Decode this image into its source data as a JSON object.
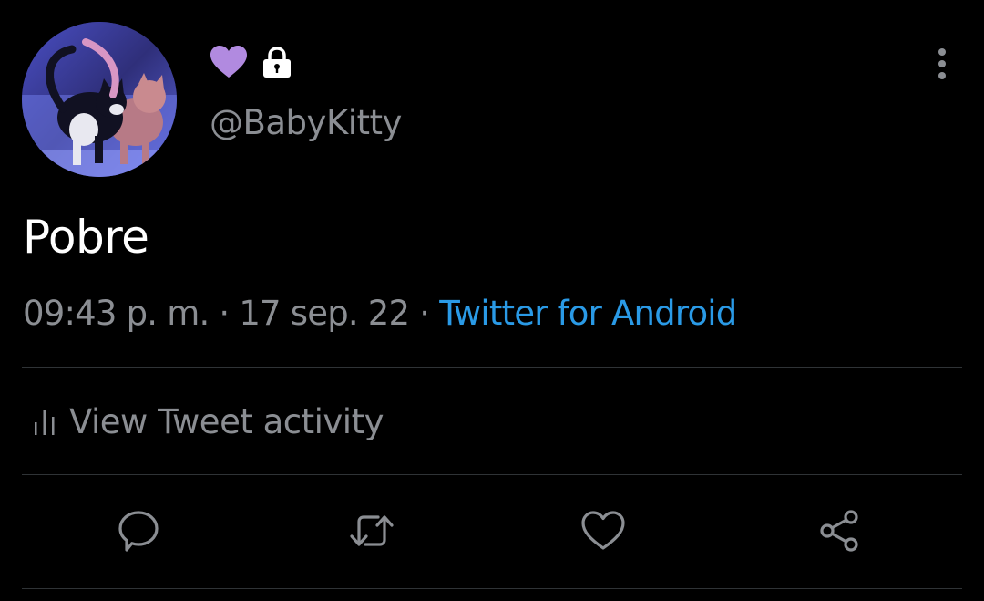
{
  "header": {
    "handle": "@BabyKitty"
  },
  "tweet": {
    "text": "Pobre",
    "time": "09:43 p. m.",
    "separator": "·",
    "date": "17 sep. 22",
    "source": "Twitter for Android"
  },
  "activity": {
    "label": "View Tweet activity"
  },
  "icons": {
    "heart_emoji": "purple-heart-icon",
    "lock": "lock-icon",
    "more": "more-vertical-icon",
    "analytics": "bar-chart-icon",
    "reply": "reply-icon",
    "retweet": "retweet-icon",
    "like": "heart-icon",
    "share": "share-icon"
  },
  "colors": {
    "background": "#000000",
    "primary_text": "#ffffff",
    "secondary_text": "#8b8e93",
    "link": "#2a9ae6",
    "heart_emoji": "#b18ae0",
    "divider": "#2f3336"
  }
}
